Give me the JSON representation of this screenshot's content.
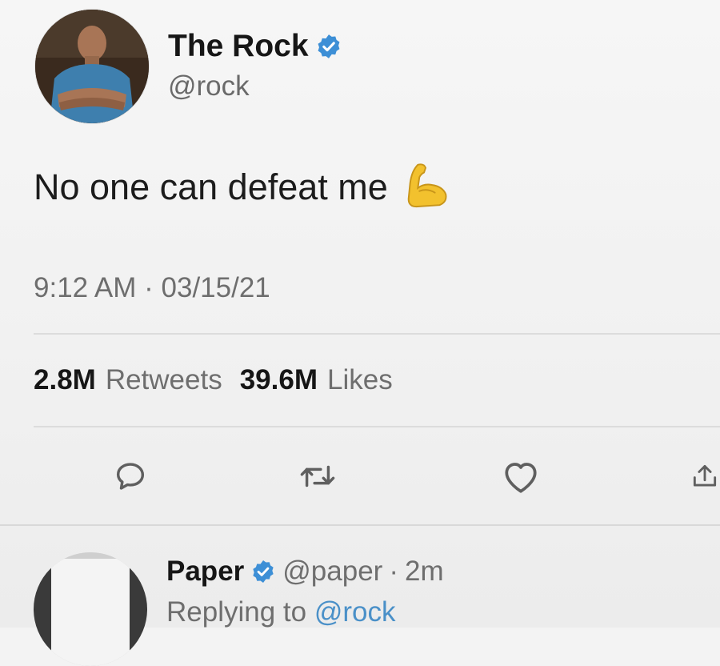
{
  "tweet": {
    "author": {
      "display_name": "The Rock",
      "handle": "@rock",
      "verified": true,
      "avatar_icon": "profile-photo"
    },
    "text": "No one can defeat me",
    "emoji": "flexed-biceps",
    "timestamp": "9:12 AM · 03/15/21",
    "stats": {
      "retweets_count": "2.8M",
      "retweets_label": "Retweets",
      "likes_count": "39.6M",
      "likes_label": "Likes"
    },
    "actions": [
      {
        "name": "reply",
        "icon": "speech-bubble-icon"
      },
      {
        "name": "retweet",
        "icon": "retweet-arrows-icon"
      },
      {
        "name": "like",
        "icon": "heart-icon"
      },
      {
        "name": "share",
        "icon": "share-icon"
      }
    ]
  },
  "reply": {
    "display_name": "Paper",
    "handle": "@paper",
    "separator": "·",
    "time": "2m",
    "verified": true,
    "replying_to_prefix": "Replying to",
    "replying_to_handle": "@rock"
  },
  "colors": {
    "verified_blue": "#3d8fd6",
    "link_blue": "#4a90c8",
    "emoji_yellow": "#f2c12e",
    "muted_text": "#6e6e6e"
  }
}
